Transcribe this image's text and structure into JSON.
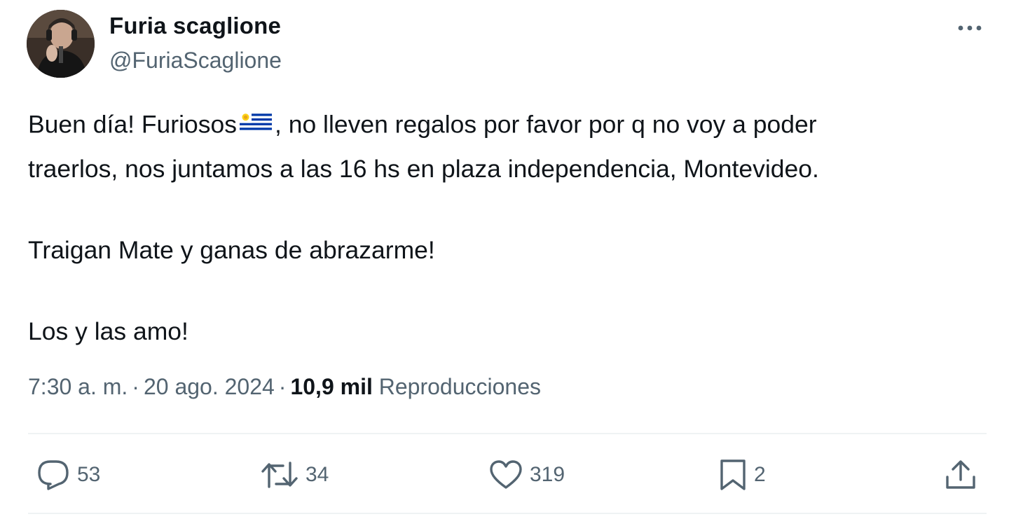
{
  "author": {
    "display_name": "Furia scaglione",
    "handle": "@FuriaScaglione",
    "avatar_icon": "profile-photo"
  },
  "tweet": {
    "line1_before_flag": "Buen día! Furiosos",
    "flag_icon": "uruguay-flag",
    "line1_after_flag": ",  no lleven regalos por favor por q no voy a poder",
    "line2": "traerlos, nos juntamos a las 16 hs en plaza independencia, Montevideo.",
    "paragraph2": "Traigan Mate y ganas de abrazarme!",
    "paragraph3": "Los y las amo!"
  },
  "meta": {
    "time": "7:30 a. m.",
    "separator": "·",
    "date": "20 ago. 2024",
    "views_count": "10,9 mil",
    "views_label": "Reproducciones"
  },
  "actions": {
    "replies": "53",
    "retweets": "34",
    "likes": "319",
    "bookmarks": "2"
  },
  "colors": {
    "text": "#0f1419",
    "secondary": "#536471",
    "divider": "#eff3f4",
    "flag_blue": "#0038a8",
    "flag_sun": "#fcd116"
  }
}
